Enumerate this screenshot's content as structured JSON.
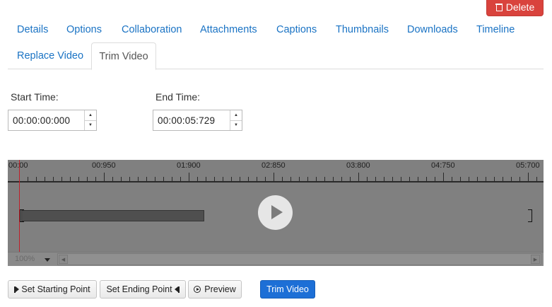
{
  "header": {
    "delete_label": "Delete"
  },
  "tabs": [
    {
      "label": "Details"
    },
    {
      "label": "Options"
    },
    {
      "label": "Collaboration"
    },
    {
      "label": "Attachments"
    },
    {
      "label": "Captions"
    },
    {
      "label": "Thumbnails"
    },
    {
      "label": "Downloads"
    },
    {
      "label": "Timeline"
    },
    {
      "label": "Replace Video"
    },
    {
      "label": "Trim Video",
      "active": true
    }
  ],
  "trim": {
    "start_label": "Start Time:",
    "start_value": "00:00:00:000",
    "end_label": "End Time:",
    "end_value": "00:00:05:729"
  },
  "timeline": {
    "ticks": [
      "00:00",
      "00:950",
      "01:900",
      "02:850",
      "03:800",
      "04:750",
      "05:700"
    ],
    "zoom": "100%"
  },
  "buttons": {
    "set_start": "Set Starting Point",
    "set_end": "Set Ending Point",
    "preview": "Preview",
    "trim": "Trim Video"
  },
  "colors": {
    "delete": "#d9433d",
    "link": "#1a73c4",
    "primary": "#1d6fd6",
    "playhead": "#c0202a"
  },
  "icons": {
    "delete": "trash-icon",
    "play": "play-icon",
    "set_start": "skip-start-icon",
    "set_end": "skip-end-icon",
    "preview": "play-circle-icon"
  }
}
